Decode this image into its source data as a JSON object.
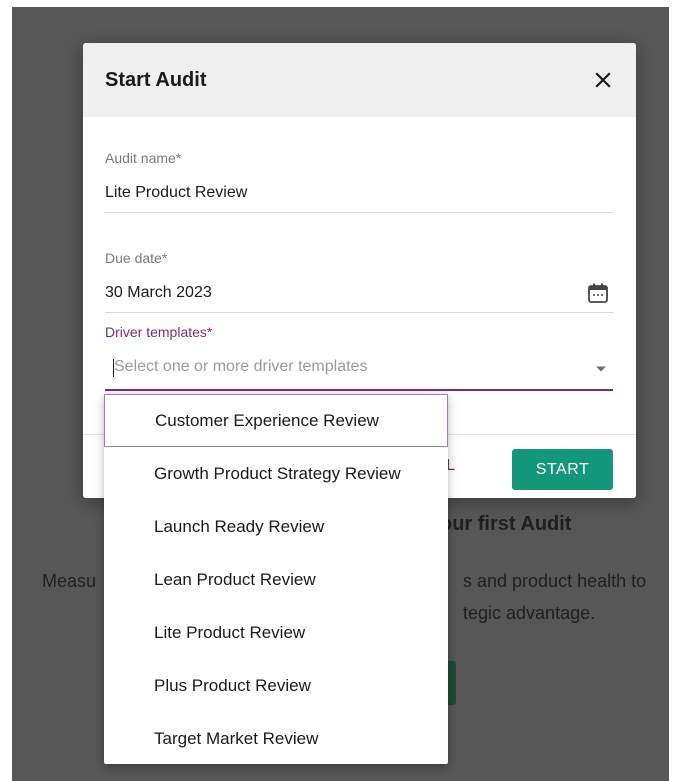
{
  "background": {
    "heading": "our first Audit",
    "text_left": "Measu",
    "text_right_1": "s and product health to",
    "text_right_2": "tegic advantage."
  },
  "dialog": {
    "title": "Start Audit",
    "close_icon": "close-icon",
    "audit_name": {
      "label": "Audit name*",
      "value": "Lite Product Review"
    },
    "due_date": {
      "label": "Due date*",
      "value": "30 March 2023",
      "icon": "calendar-icon"
    },
    "driver_templates": {
      "label": "Driver templates*",
      "placeholder": "Select one or more driver templates",
      "icon": "chevron-down-icon",
      "options": [
        "Customer Experience Review",
        "Growth Product Strategy Review",
        "Launch Ready Review",
        "Lean Product Review",
        "Lite Product Review",
        "Plus Product Review",
        "Target Market Review"
      ],
      "focused_option": "Customer Experience Review"
    },
    "cancel_label": "CEL",
    "start_label": "START"
  },
  "colors": {
    "accent_purple": "#7b2a7b",
    "start_green": "#14967a",
    "backdrop": "#575757"
  }
}
